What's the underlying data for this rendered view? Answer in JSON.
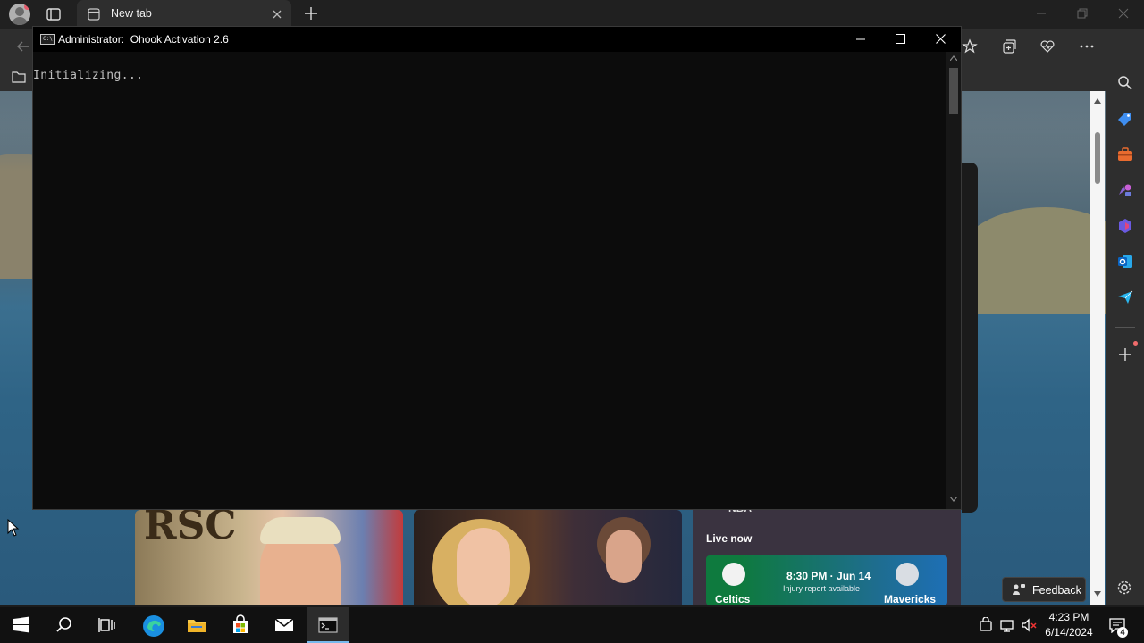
{
  "browser": {
    "tab": {
      "title": "New tab"
    }
  },
  "console": {
    "title_prefix": "Administrator:",
    "title": "Ohook Activation 2.6",
    "icon_text": "C:\\",
    "output_line": "Initializing..."
  },
  "news": {
    "nba": {
      "league": "NBA",
      "live_label": "Live now",
      "game": {
        "home": "Celtics",
        "away": "Mavericks",
        "time": "8:30 PM · Jun 14",
        "note": "Injury report available"
      }
    },
    "feedback_label": "Feedback"
  },
  "taskbar": {
    "time": "4:23 PM",
    "date": "6/14/2024",
    "notification_count": "4",
    "items": [
      "start-icon",
      "search-icon",
      "task-view-icon",
      "edge-icon",
      "file-explorer-icon",
      "store-icon",
      "mail-icon",
      "terminal-icon"
    ]
  },
  "colors": {
    "taskbar_accent": "#76b9ed",
    "console_bg": "#0c0c0c",
    "console_text": "#c0c0c0",
    "browser_chrome": "#2e2e2e"
  }
}
